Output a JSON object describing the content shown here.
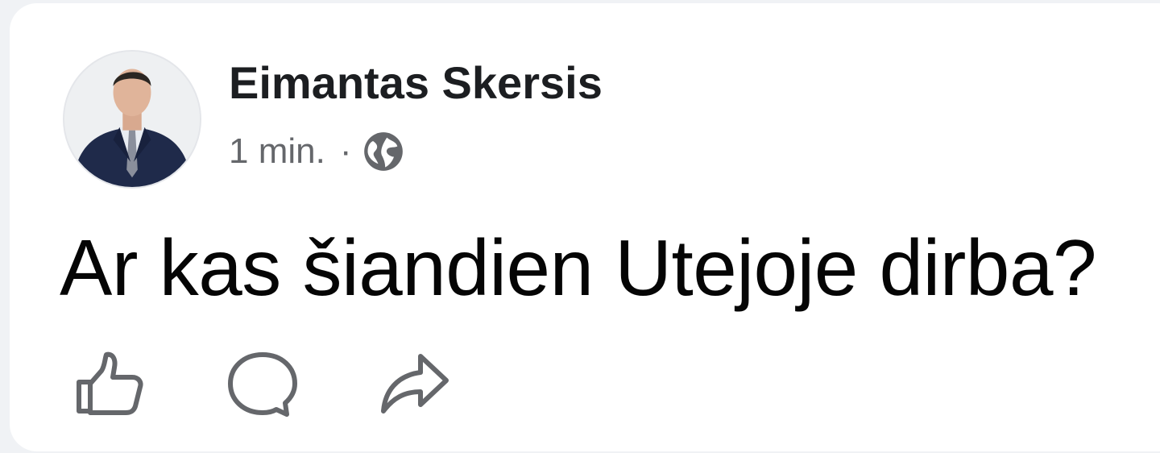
{
  "post": {
    "author_name": "Eimantas Skersis",
    "timestamp": "1 min.",
    "separator": "·",
    "audience_icon": "globe-icon",
    "text": "Ar kas šiandien Utejoje dirba?"
  },
  "actions": [
    {
      "icon": "thumbs-up-icon"
    },
    {
      "icon": "speech-bubble-icon"
    },
    {
      "icon": "share-arrow-icon"
    }
  ],
  "colors": {
    "background": "#f0f2f5",
    "card": "#ffffff",
    "primary_text": "#050505",
    "secondary_text": "#65676b",
    "icon_stroke": "#65676b"
  }
}
